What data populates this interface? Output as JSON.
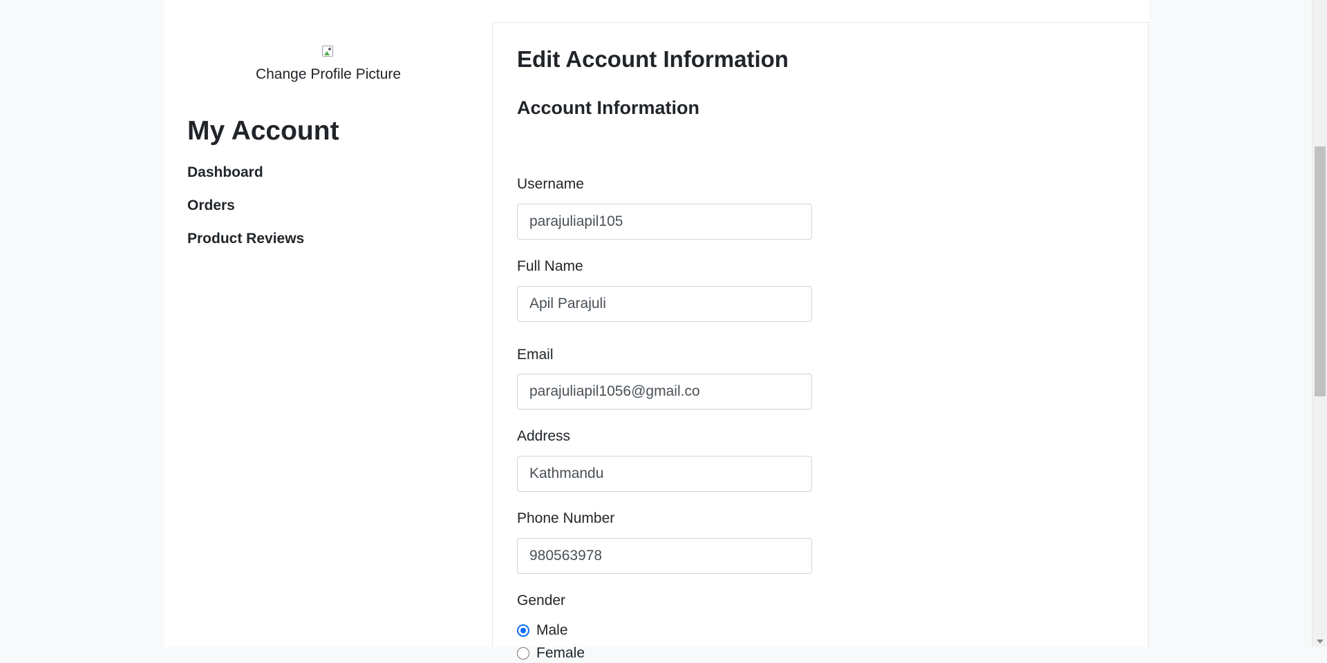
{
  "sidebar": {
    "avatar_icon": "broken-image-icon",
    "change_picture_label": "Change Profile Picture",
    "heading": "My Account",
    "nav_items": [
      {
        "label": "Dashboard"
      },
      {
        "label": "Orders"
      },
      {
        "label": "Product Reviews"
      }
    ]
  },
  "form": {
    "title": "Edit Account Information",
    "section_title": "Account Information",
    "username": {
      "label": "Username",
      "value": "parajuliapil105"
    },
    "full_name": {
      "label": "Full Name",
      "value": "Apil Parajuli"
    },
    "email": {
      "label": "Email",
      "value": "parajuliapil1056@gmail.co"
    },
    "address": {
      "label": "Address",
      "value": "Kathmandu"
    },
    "phone": {
      "label": "Phone Number",
      "value": "980563978"
    },
    "gender": {
      "label": "Gender",
      "options": [
        {
          "label": "Male",
          "selected": true
        },
        {
          "label": "Female",
          "selected": false
        }
      ]
    }
  },
  "colors": {
    "accent": "#0d6efd",
    "page_background": "#f8f9fa",
    "card_border": "#e3e6ea"
  }
}
